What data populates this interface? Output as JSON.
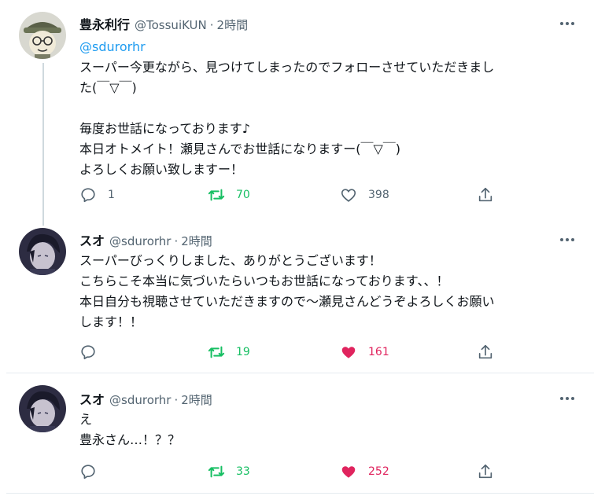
{
  "colors": {
    "accent": "#1d9bf0",
    "retweet_active": "#17bf63",
    "like_active": "#e0245e",
    "secondary_text": "#536471",
    "divider": "#e6ecf0"
  },
  "tweets": [
    {
      "display_name": "豊永利行",
      "handle": "@TossuiKUN",
      "separator": "·",
      "time": "2時間",
      "mention": "@sdurorhr",
      "lines": [
        "スーパー今更ながら、見つけてしまったのでフォローさせていただきまし",
        "た(￣▽￣)",
        "",
        "毎度お世話になっております♪",
        "本日オトメイト！瀬見さんでお世話になりますー(￣▽￣)",
        "よろしくお願い致しますー！"
      ],
      "reply_count": "1",
      "retweet_count": "70",
      "like_count": "398",
      "retweeted": true,
      "liked": false
    },
    {
      "display_name": "スオ",
      "handle": "@sdurorhr",
      "separator": "·",
      "time": "2時間",
      "lines": [
        "スーパーびっくりしました、ありがとうございます！",
        "こちらこそ本当に気づいたらいつもお世話になっております、、！",
        "本日自分も視聴させていただきますので～瀬見さんどうぞよろしくお願い",
        "します！！"
      ],
      "reply_count": "",
      "retweet_count": "19",
      "like_count": "161",
      "retweeted": true,
      "liked": true
    },
    {
      "display_name": "スオ",
      "handle": "@sdurorhr",
      "separator": "·",
      "time": "2時間",
      "lines": [
        "え",
        "豊永さん…！？？"
      ],
      "reply_count": "",
      "retweet_count": "33",
      "like_count": "252",
      "retweeted": true,
      "liked": true
    }
  ],
  "icons": {
    "reply": "reply-icon",
    "retweet": "retweet-icon",
    "like": "heart-icon",
    "share": "share-icon",
    "more": "more-dots-icon"
  }
}
